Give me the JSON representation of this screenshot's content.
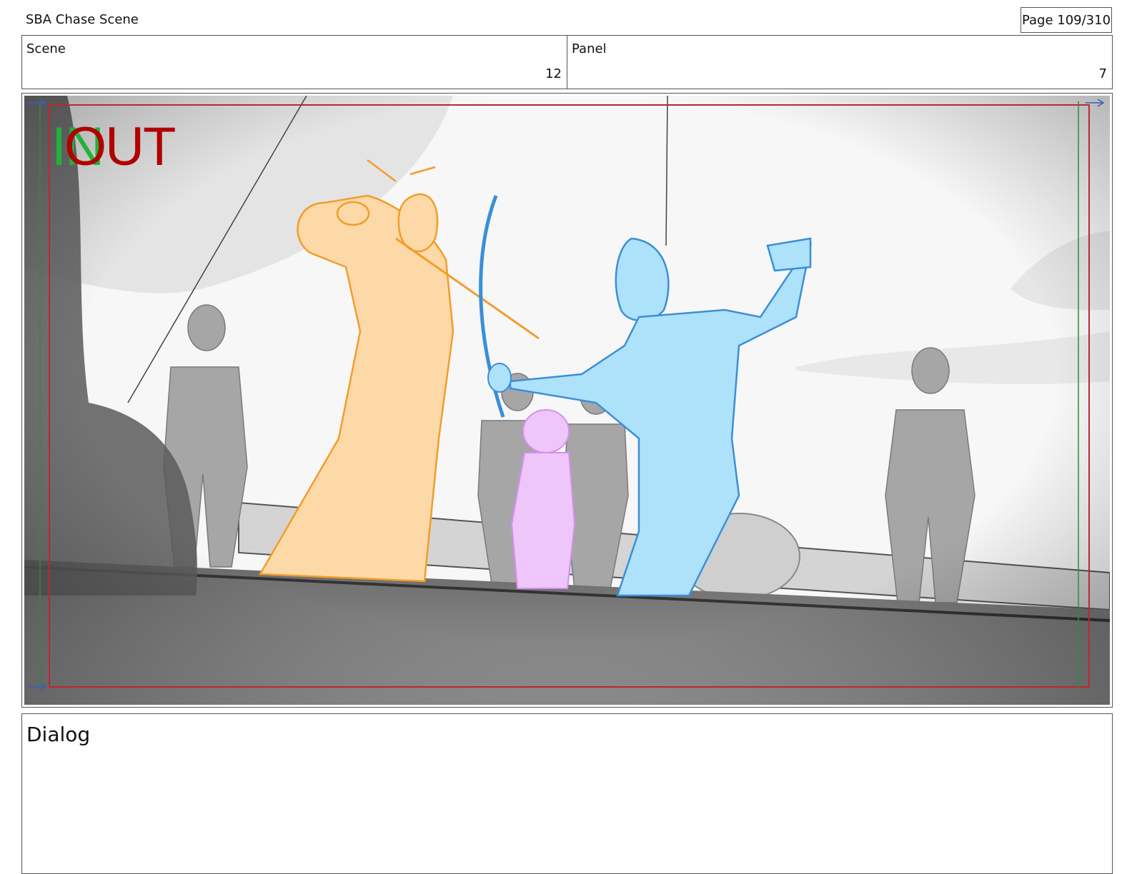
{
  "header": {
    "title": "SBA Chase Scene",
    "page": "Page 109/310"
  },
  "info": {
    "scene_label": "Scene",
    "scene_value": "12",
    "panel_label": "Panel",
    "panel_value": "7"
  },
  "frame": {
    "marker_in": "IN",
    "marker_out": "OUT",
    "colors": {
      "in_marker": "#1fb33a",
      "out_marker": "#b00000",
      "safe_frame_red": "#c0262d",
      "safe_frame_green": "#2e8b3a",
      "orange_character": "#f39c2b",
      "blue_character": "#5ab8f0",
      "pink_character": "#d88ef0",
      "grey_background": "#9c9c9c"
    }
  },
  "dialog": {
    "label": "Dialog"
  }
}
